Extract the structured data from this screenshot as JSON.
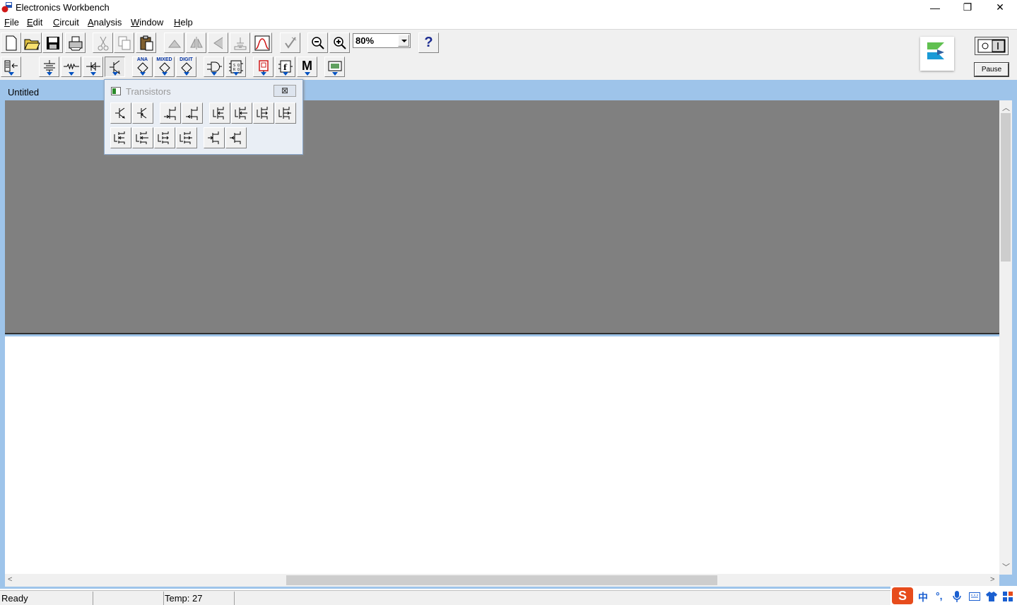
{
  "window": {
    "title": "Electronics Workbench",
    "minimize_glyph": "—",
    "restore_glyph": "❐",
    "close_glyph": "✕"
  },
  "menu": {
    "items": [
      {
        "label": "File",
        "accel": "F",
        "rest": "ile"
      },
      {
        "label": "Edit",
        "accel": "E",
        "rest": "dit"
      },
      {
        "label": "Circuit",
        "accel": "C",
        "rest": "ircuit"
      },
      {
        "label": "Analysis",
        "accel": "A",
        "rest": "nalysis"
      },
      {
        "label": "Window",
        "accel": "W",
        "rest": "indow"
      },
      {
        "label": "Help",
        "accel": "H",
        "rest": "elp"
      }
    ]
  },
  "toolbar": {
    "zoom_value": "80%",
    "help_glyph": "?",
    "bin_label_ana": "ANA",
    "bin_label_mixed": "MIXED",
    "bin_label_digit": "DIGIT",
    "bin_label_misc": "M",
    "pause_label": "Pause",
    "power_label": "O I"
  },
  "mdi": {
    "document_title": "Untitled"
  },
  "palette": {
    "title": "Transistors",
    "close_glyph": "⊠",
    "row1_count": 8,
    "row2_count": 6
  },
  "status": {
    "state": "Ready",
    "temp_label": "Temp:  27"
  },
  "ime": {
    "logo": "S",
    "lang": "中",
    "punct": "°,"
  },
  "colors": {
    "mdi_frame": "#9ec4ea",
    "workspace_gray": "#808080",
    "accent_blue": "#0050c0",
    "ime_orange": "#e74c1c"
  }
}
